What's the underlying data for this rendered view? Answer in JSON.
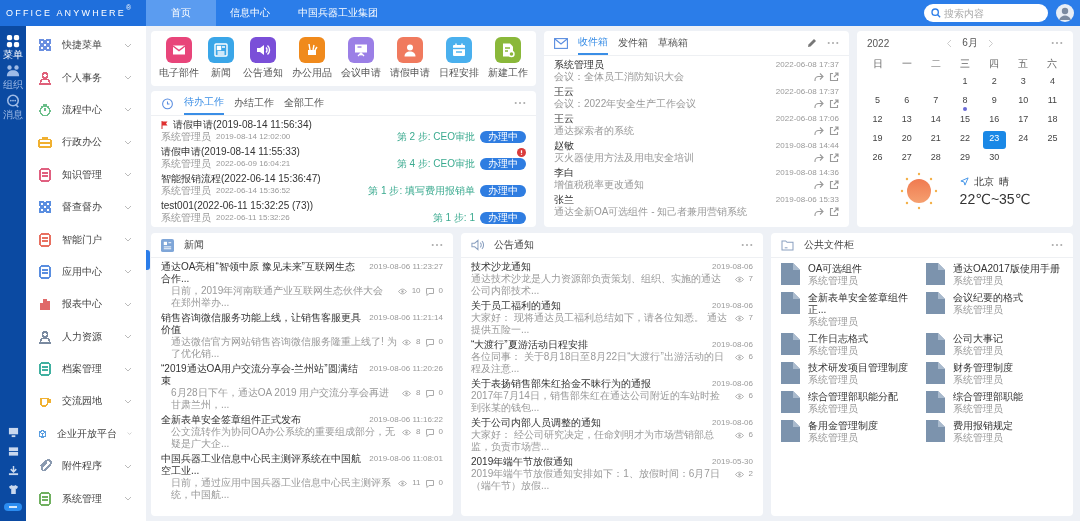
{
  "topbar": {
    "logo": "OFFICE ANYWHERE",
    "logo_mark": "®",
    "tabs": [
      {
        "label": "首页",
        "selected": true
      },
      {
        "label": "信息中心",
        "selected": false
      },
      {
        "label": "中国兵器工业集团",
        "selected": false
      }
    ],
    "search": {
      "placeholder": "搜索内容"
    }
  },
  "rail": {
    "items": [
      {
        "label": "菜单",
        "kind": "grid",
        "selected": true
      },
      {
        "label": "组织",
        "kind": "org",
        "selected": false
      },
      {
        "label": "消息",
        "kind": "chat",
        "selected": false
      }
    ],
    "tools": [
      {
        "kind": "monitor"
      },
      {
        "kind": "server"
      },
      {
        "kind": "download"
      },
      {
        "kind": "shirt"
      },
      {
        "kind": "toggle"
      }
    ]
  },
  "sidebar": {
    "items": [
      {
        "label": "快捷菜单",
        "kind": "grid",
        "color": "#6a8fe0"
      },
      {
        "label": "个人事务",
        "kind": "person",
        "color": "#e0607a"
      },
      {
        "label": "流程中心",
        "kind": "clock",
        "color": "#6bbf8a"
      },
      {
        "label": "行政办公",
        "kind": "briefcase",
        "color": "#f0b030"
      },
      {
        "label": "知识管理",
        "kind": "doc",
        "color": "#e06080"
      },
      {
        "label": "督查督办",
        "kind": "grid",
        "color": "#5a8ee0"
      },
      {
        "label": "智能门户",
        "kind": "doc",
        "color": "#e87060"
      },
      {
        "label": "应用中心",
        "kind": "doc",
        "color": "#5a8ee0"
      },
      {
        "label": "报表中心",
        "kind": "chart",
        "color": "#e06a6a"
      },
      {
        "label": "人力资源",
        "kind": "person",
        "color": "#7a8aa0"
      },
      {
        "label": "档案管理",
        "kind": "doc",
        "color": "#40b0a0"
      },
      {
        "label": "交流园地",
        "kind": "cup",
        "color": "#f0b030"
      },
      {
        "label": "企业开放平台",
        "kind": "cube",
        "color": "#5a9ee0"
      },
      {
        "label": "附件程序",
        "kind": "clip",
        "color": "#8a9ab0"
      },
      {
        "label": "系统管理",
        "kind": "doc",
        "color": "#70b060"
      }
    ]
  },
  "apps": [
    {
      "label": "电子部件",
      "kind": "mail",
      "color": "#e8457a"
    },
    {
      "label": "新闻",
      "kind": "news",
      "color": "#3aa6e8"
    },
    {
      "label": "公告通知",
      "kind": "speaker",
      "color": "#7a4fd8"
    },
    {
      "label": "办公用品",
      "kind": "tools",
      "color": "#f08a1c"
    },
    {
      "label": "会议申请",
      "kind": "presentation",
      "color": "#9b7fe6"
    },
    {
      "label": "请假申请",
      "kind": "person",
      "color": "#f07a5e"
    },
    {
      "label": "日程安排",
      "kind": "calendar",
      "color": "#4ab0ee"
    },
    {
      "label": "新建工作",
      "kind": "document",
      "color": "#8ab83a"
    }
  ],
  "todo": {
    "tabs": [
      {
        "label": "待办工作",
        "selected": true
      },
      {
        "label": "办结工作",
        "selected": false
      },
      {
        "label": "全部工作",
        "selected": false
      }
    ],
    "items": [
      {
        "title": "请假申请(2019-08-14 11:56:34)",
        "flagged": true,
        "urgent": false,
        "user": "系统管理员",
        "time": "2019-08-14 12:02:00",
        "step": "第 2 步: CEO审批",
        "status": "办理中"
      },
      {
        "title": "请假申请(2019-08-14 11:55:33)",
        "flagged": false,
        "urgent": true,
        "user": "系统管理员",
        "time": "2022-06-09 16:04:21",
        "step": "第 4 步: CEO审批",
        "status": "办理中"
      },
      {
        "title": "智能报销流程(2022-06-14 15:36:47)",
        "flagged": false,
        "urgent": false,
        "user": "系统管理员",
        "time": "2022-06-14 15:36:52",
        "step": "第 1 步: 填写费用报销单",
        "status": "办理中"
      },
      {
        "title": "test001(2022-06-11 15:32:25 (73))",
        "flagged": false,
        "urgent": false,
        "user": "系统管理员",
        "time": "2022-06-11 15:32:26",
        "step": "第 1 步: 1",
        "status": "办理中"
      }
    ]
  },
  "mail": {
    "tabs": [
      {
        "label": "收件箱",
        "selected": true
      },
      {
        "label": "发件箱",
        "selected": false
      },
      {
        "label": "草稿箱",
        "selected": false
      }
    ],
    "items": [
      {
        "sender": "系统管理员",
        "time": "2022-06-08 17:37",
        "subject": "会议：全体员工消防知识大会"
      },
      {
        "sender": "王云",
        "time": "2022-06-08 17:37",
        "subject": "会议：2022年安全生产工作会议"
      },
      {
        "sender": "王云",
        "time": "2022-06-08 17:06",
        "subject": "通达探索者的系统"
      },
      {
        "sender": "赵敏",
        "time": "2019-08-08 14:44",
        "subject": "灭火器使用方法及用电安全培训"
      },
      {
        "sender": "李白",
        "time": "2019-08-08 14:36",
        "subject": "增值税税率更改通知"
      },
      {
        "sender": "张兰",
        "time": "2019-08-06 15:33",
        "subject": "通达全新OA可选组件 - 知己者兼用营销系统"
      }
    ]
  },
  "calendar": {
    "year": "2022",
    "month": "6月",
    "weekdays": [
      "日",
      "一",
      "二",
      "三",
      "四",
      "五",
      "六"
    ],
    "weeks": [
      [
        {
          "kind": "blank"
        },
        {
          "kind": "blank"
        },
        {
          "kind": "blank"
        },
        {
          "day": "1",
          "selected": false,
          "event": false
        },
        {
          "day": "2",
          "selected": false,
          "event": false
        },
        {
          "day": "3",
          "selected": false,
          "event": false
        },
        {
          "day": "4",
          "selected": false,
          "event": false
        }
      ],
      [
        {
          "day": "5",
          "selected": false,
          "event": false
        },
        {
          "day": "6",
          "selected": false,
          "event": false
        },
        {
          "day": "7",
          "selected": false,
          "event": false
        },
        {
          "day": "8",
          "selected": false,
          "event": true
        },
        {
          "day": "9",
          "selected": false,
          "event": false
        },
        {
          "day": "10",
          "selected": false,
          "event": false
        },
        {
          "day": "11",
          "selected": false,
          "event": false
        }
      ],
      [
        {
          "day": "12",
          "selected": false,
          "event": false
        },
        {
          "day": "13",
          "selected": false,
          "event": false
        },
        {
          "day": "14",
          "selected": false,
          "event": false
        },
        {
          "day": "15",
          "selected": false,
          "event": false
        },
        {
          "day": "16",
          "selected": false,
          "event": false
        },
        {
          "day": "17",
          "selected": false,
          "event": false
        },
        {
          "day": "18",
          "selected": false,
          "event": false
        }
      ],
      [
        {
          "day": "19",
          "selected": false,
          "event": false
        },
        {
          "day": "20",
          "selected": false,
          "event": false
        },
        {
          "day": "21",
          "selected": false,
          "event": false
        },
        {
          "day": "22",
          "selected": false,
          "event": false
        },
        {
          "day": "23",
          "selected": true,
          "event": false
        },
        {
          "day": "24",
          "selected": false,
          "event": false
        },
        {
          "day": "25",
          "selected": false,
          "event": false
        }
      ],
      [
        {
          "day": "26",
          "selected": false,
          "event": false
        },
        {
          "day": "27",
          "selected": false,
          "event": false
        },
        {
          "day": "28",
          "selected": false,
          "event": false
        },
        {
          "day": "29",
          "selected": false,
          "event": false
        },
        {
          "day": "30",
          "selected": false,
          "event": false
        },
        {
          "kind": "blank"
        },
        {
          "kind": "blank"
        }
      ]
    ],
    "weather": {
      "city": "北京",
      "condition": "晴",
      "temperature": "22℃~35℃"
    }
  },
  "news": {
    "title": "新闻",
    "items": [
      {
        "title": "通达OA亮相“智领中原 豫见未来”互联网生态合作...",
        "time": "2019-08-06 11:23:27",
        "summary": "日前，2019年河南联通产业互联网生态伙伴大会在郑州举办...",
        "views": "10",
        "comments": "0"
      },
      {
        "title": "销售咨询微信服务功能上线，让销售客服更具价值",
        "time": "2019-08-06 11:21:14",
        "summary": "通达微信官方网站销售咨询微信服务隆重上线了! 为了优化销...",
        "views": "8",
        "comments": "0"
      },
      {
        "title": "“2019通达OA用户交流分享会-兰州站”圆满结束",
        "time": "2019-08-06 11:20:26",
        "summary": "6月28日下午，通达OA 2019 用户交流分享会再进甘肃兰州，...",
        "views": "8",
        "comments": "0"
      },
      {
        "title": "全新表单安全签章组件正式发布",
        "time": "2019-08-06 11:16:22",
        "summary": "公文流转作为协同OA办公系统的重要组成部分，无疑是广大企...",
        "views": "8",
        "comments": "0"
      },
      {
        "title": "中国兵器工业信息中心民主测评系统在中国航空工业...",
        "time": "2019-08-06 11:08:01",
        "summary": "日前，通过应用中国兵器工业信息中心民主测评系统，中国航...",
        "views": "11",
        "comments": "0"
      }
    ]
  },
  "notices": {
    "title": "公告通知",
    "items": [
      {
        "title": "技术沙龙通知",
        "date": "2019-08-06",
        "summary": "通达技术沙龙是人力资源部负责策划、组织、实施的通达公司内部技术...",
        "views": "7"
      },
      {
        "title": "关于员工福利的通知",
        "date": "2019-08-06",
        "summary": "大家好：  现将通达员工福利总结如下，请各位知悉。  通达提供五险一...",
        "views": "7"
      },
      {
        "title": "“大渡行”夏游活动日程安排",
        "date": "2019-08-06",
        "summary": "各位同事：  关于8月18日至8月22日“大渡行”出游活动的日程及注意...",
        "views": "6"
      },
      {
        "title": "关于表扬销售部朱红拾金不昧行为的通报",
        "date": "2019-08-06",
        "summary": "2017年7月14日，销售部朱红在通达公司附近的车站时捡到张某的钱包...",
        "views": "6"
      },
      {
        "title": "关于公司内部人员调整的通知",
        "date": "2019-08-06",
        "summary": "大家好：  经公司研究决定，任命刘明才为市场营销部总监，负责市场营...",
        "views": "6"
      },
      {
        "title": "2019年端午节放假通知",
        "date": "2019-05-30",
        "summary": "2019年端午节放假通知安排如下：1、放假时间：6月7日（端午节）放假...",
        "views": "2"
      }
    ]
  },
  "files": {
    "title": "公共文件柜",
    "items": [
      {
        "name": "OA可选组件",
        "owner": "系统管理员"
      },
      {
        "name": "通达OA2017版使用手册",
        "owner": "系统管理员"
      },
      {
        "name": "全新表单安全签章组件正...",
        "owner": "系统管理员"
      },
      {
        "name": "会议纪要的格式",
        "owner": "系统管理员"
      },
      {
        "name": "工作日志格式",
        "owner": "系统管理员"
      },
      {
        "name": "公司大事记",
        "owner": "系统管理员"
      },
      {
        "name": "技术研发项目管理制度",
        "owner": "系统管理员"
      },
      {
        "name": "财务管理制度",
        "owner": "系统管理员"
      },
      {
        "name": "综合管理部职能分配",
        "owner": "系统管理员"
      },
      {
        "name": "综合管理部职能",
        "owner": "系统管理员"
      },
      {
        "name": "备用金管理制度",
        "owner": "系统管理员"
      },
      {
        "name": "费用报销规定",
        "owner": "系统管理员"
      }
    ]
  }
}
